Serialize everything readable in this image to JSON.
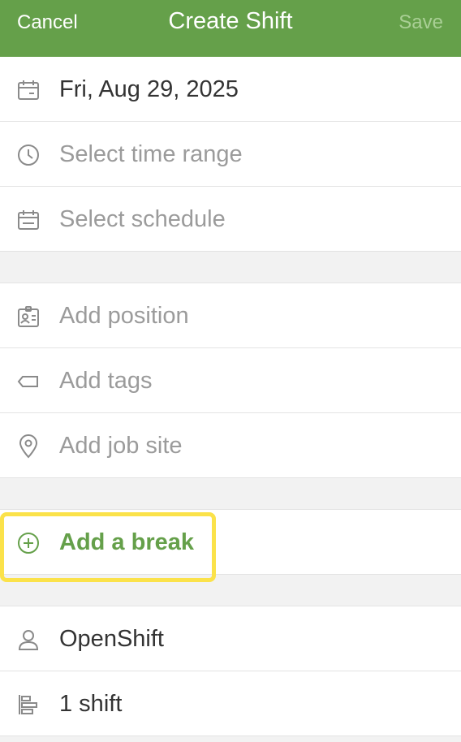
{
  "nav": {
    "cancel_label": "Cancel",
    "title": "Create Shift",
    "save_label": "Save"
  },
  "fields": {
    "date": {
      "icon": "calendar-icon",
      "value": "Fri, Aug 29, 2025"
    },
    "time_range": {
      "icon": "clock-icon",
      "placeholder": "Select time range"
    },
    "schedule": {
      "icon": "schedule-icon",
      "placeholder": "Select schedule"
    },
    "position": {
      "icon": "id-badge-icon",
      "placeholder": "Add position"
    },
    "tags": {
      "icon": "tag-icon",
      "placeholder": "Add tags"
    },
    "job_site": {
      "icon": "location-pin-icon",
      "placeholder": "Add job site"
    },
    "break": {
      "icon": "plus-circle-icon",
      "label": "Add a break"
    },
    "assignee": {
      "icon": "person-icon",
      "value": "OpenShift"
    },
    "shift_count": {
      "icon": "shifts-icon",
      "value": "1 shift"
    }
  },
  "colors": {
    "brand_green": "#65a04a",
    "highlight_yellow": "#fbe24a",
    "placeholder_gray": "#9b9b9b"
  }
}
